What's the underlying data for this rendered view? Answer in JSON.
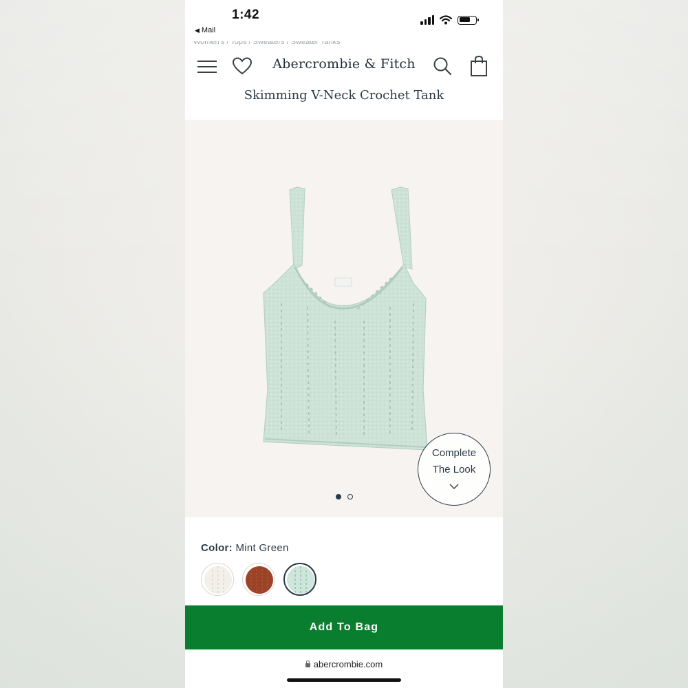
{
  "status_bar": {
    "time": "1:42",
    "back_label": "Mail"
  },
  "breadcrumb": "Women's  /  Tops  /  Sweaters  /  Sweater Tanks",
  "header": {
    "logo": "Abercrombie & Fitch",
    "product_title": "Skimming V-Neck Crochet Tank"
  },
  "gallery": {
    "image_label": "Skimming V-Neck Crochet Tank in Mint Green",
    "page_count": 2,
    "current_page": 1,
    "complete_look": {
      "line1": "Complete",
      "line2": "The Look"
    }
  },
  "color": {
    "label": "Color:",
    "selected": "Mint Green",
    "swatches": [
      {
        "name": "Cream",
        "hex": "#f3efe9",
        "selected": false
      },
      {
        "name": "Rust",
        "hex": "#9a4326",
        "selected": false
      },
      {
        "name": "Mint Green",
        "hex": "#cfe6dc",
        "selected": true
      }
    ]
  },
  "actions": {
    "add_to_bag": "Add To Bag"
  },
  "browser": {
    "url": "abercrombie.com"
  },
  "colors": {
    "brand_navy": "#2c3a47",
    "add_to_bag_green": "#0a7e2f",
    "product_mint": "#cde3d8"
  }
}
